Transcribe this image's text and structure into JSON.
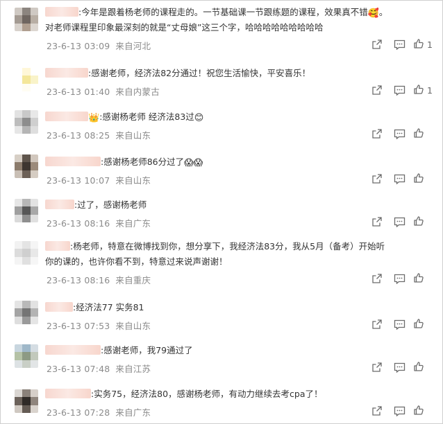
{
  "comments": [
    {
      "name_blur": "■■■■",
      "pre": ":今年是跟着杨老师的课程走的。一节基础课一节跟练题的课程，效果真不错",
      "emoji": "🥰",
      "post": "。对老师课程里印象最深刻的就是“丈母娘”这三个字，哈哈哈哈哈哈哈哈哈",
      "date": "23-6-13 03:09",
      "loc": "来自河北",
      "likes": "1",
      "avatar": [
        "#cfc9c3",
        "#8c857f",
        "#cfc9c3",
        "#a49b93",
        "#6f6660",
        "#b8aea4",
        "#d8d2cc",
        "#b09f90",
        "#dcd6d0"
      ]
    },
    {
      "name_blur": "■■■■",
      "pre": ":感谢老师，经济法82分通过！祝您生活愉快，平安喜乐！",
      "emoji": "",
      "post": "",
      "date": "23-6-13 01:40",
      "loc": "来自内蒙古",
      "likes": "1",
      "avatar": [
        "#ffffff",
        "#fff7d8",
        "#ffffff",
        "#ffffff",
        "#f4e79a",
        "#f9f3c9",
        "#ffffff",
        "#fffdf3",
        "#ffffff"
      ]
    },
    {
      "name_blur": "■■■■",
      "pre": ":感谢杨老师 经济法83过",
      "emoji": "😊",
      "post": "",
      "prefix_emoji": "👑",
      "date": "23-6-13 08:25",
      "loc": "来自山东",
      "likes": "",
      "avatar": [
        "#e2e2e2",
        "#c9c9c9",
        "#e8e8e8",
        "#bdbdbd",
        "#8d8d8d",
        "#cfcfcf",
        "#e6e6e6",
        "#b5b5b5",
        "#dedede"
      ]
    },
    {
      "name_blur": "■■■■",
      "pre": ":感谢杨老师86分过了",
      "emoji": "😱😱",
      "post": "",
      "date": "23-6-13 10:07",
      "loc": "来自山东",
      "likes": "",
      "avatar": [
        "#d7cfc6",
        "#5f554c",
        "#d1c7bd",
        "#8c7c6c",
        "#3e3630",
        "#9c8b7b",
        "#c9bfb5",
        "#6d6157",
        "#d5ccc2"
      ]
    },
    {
      "name_blur": "■■■■",
      "pre": ":过了，感谢杨老师",
      "emoji": "",
      "post": "",
      "date": "23-6-13 08:16",
      "loc": "来自广东",
      "likes": "",
      "avatar": [
        "#e6e6e6",
        "#b7b7b7",
        "#e3e3e3",
        "#9f9f9f",
        "#575757",
        "#a8a8a8",
        "#dadada",
        "#8f8f8f",
        "#e0e0e0"
      ]
    },
    {
      "name_blur": "■■■■",
      "pre": ":杨老师，特意在微博找到你，想分享下，我经济法83分，我从5月（备考）开始听你的课的，也许你看不到，特意过来说声谢谢！",
      "emoji": "",
      "post": "",
      "date": "23-6-13 08:16",
      "loc": "来自重庆",
      "likes": "",
      "avatar": [
        "#f2f2f2",
        "#e4e4e4",
        "#f5f5f5",
        "#dcdcdc",
        "#cfcfcf",
        "#e8e8e8",
        "#f4f4f4",
        "#e0e0e0",
        "#f6f6f6"
      ]
    },
    {
      "name_blur": "■■■■",
      "pre": ":经济法77 实务81",
      "emoji": "",
      "post": "",
      "date": "23-6-13 07:53",
      "loc": "来自山东",
      "likes": "",
      "avatar": [
        "#e4e4e4",
        "#b9b9b9",
        "#e2e2e2",
        "#a4a4a4",
        "#757575",
        "#b3b3b3",
        "#dedede",
        "#9a9a9a",
        "#e5e5e5"
      ]
    },
    {
      "name_blur": "■■■■",
      "pre": ":感谢老师，我79通过了",
      "emoji": "",
      "post": "",
      "date": "23-6-13 07:48",
      "loc": "来自江苏",
      "likes": "",
      "avatar": [
        "#c8d6df",
        "#9fb8c9",
        "#d5dde3",
        "#b5c2a6",
        "#8d9a84",
        "#c2c9bc",
        "#dde2e4",
        "#c9cfc6",
        "#e2e5e6"
      ]
    },
    {
      "name_blur": "■■■■",
      "pre": ":实务75，经济法80，感谢杨老师，有动力继续去考cpa了！",
      "emoji": "",
      "post": "",
      "date": "23-6-13 07:28",
      "loc": "来自广东",
      "likes": "",
      "avatar": [
        "#dad6d2",
        "#8a817a",
        "#d6cfc9",
        "#6c625b",
        "#2f2a27",
        "#8f857d",
        "#cfc8c1",
        "#645b54",
        "#d9d3cd"
      ]
    }
  ],
  "colors": {
    "meta": "#8a8a8a",
    "text": "#333333",
    "icon": "#6b6b6b"
  },
  "icons": {
    "share": "share-icon",
    "comment": "comment-icon",
    "like": "thumbs-up-icon"
  }
}
